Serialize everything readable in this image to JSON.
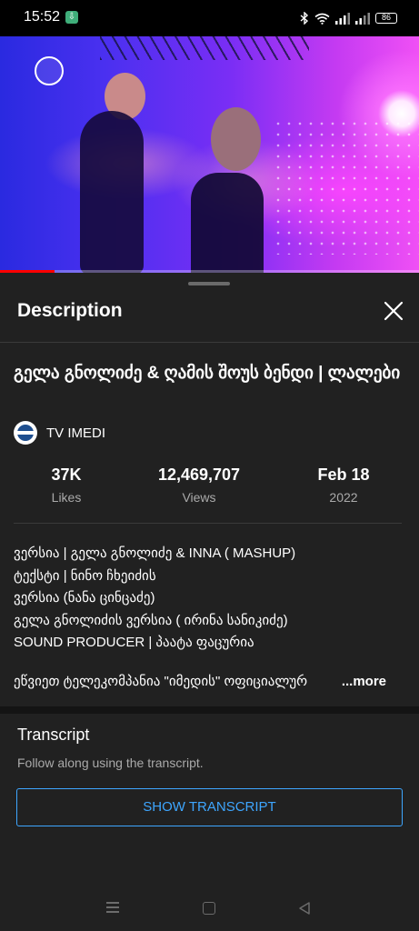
{
  "status_bar": {
    "time": "15:52",
    "battery": "86",
    "download_badge": "⇩"
  },
  "video": {
    "progress_fraction": 0.13
  },
  "description_sheet": {
    "header_title": "Description",
    "video_title": "გელა გნოლიძე & ღამის შოუს ბენდი | ლალები",
    "channel_name": "TV IMEDI",
    "stats": {
      "likes_value": "37K",
      "likes_label": "Likes",
      "views_value": "12,469,707",
      "views_label": "Views",
      "date_value": "Feb 18",
      "date_label": "2022"
    },
    "description_lines": [
      "ვერსია | გელა გნოლიძე & INNA ( MASHUP)",
      "ტექსტი | ნინო ჩხეიძის",
      "ვერსია (ნანა ცინცაძე)",
      "გელა გნოლიძის ვერსია ( ირინა სანიკიძე)",
      "SOUND PRODUCER | პაატა ფაცურია"
    ],
    "description_truncated": "ეწვიეთ ტელეკომპანია \"იმედის\" ოფიციალურ",
    "more_label": "...more"
  },
  "transcript": {
    "title": "Transcript",
    "subtitle": "Follow along using the transcript.",
    "button_label": "SHOW TRANSCRIPT"
  },
  "icons": {
    "status": [
      "download-icon",
      "bluetooth-icon",
      "wifi-icon",
      "signal-icon",
      "battery-icon"
    ],
    "sheet": [
      "close-icon"
    ],
    "nav": [
      "menu-icon",
      "home-icon",
      "back-icon"
    ]
  },
  "colors": {
    "accent_blue": "#3ea6ff",
    "progress_red": "#ff0000",
    "sheet_bg": "#212121"
  }
}
